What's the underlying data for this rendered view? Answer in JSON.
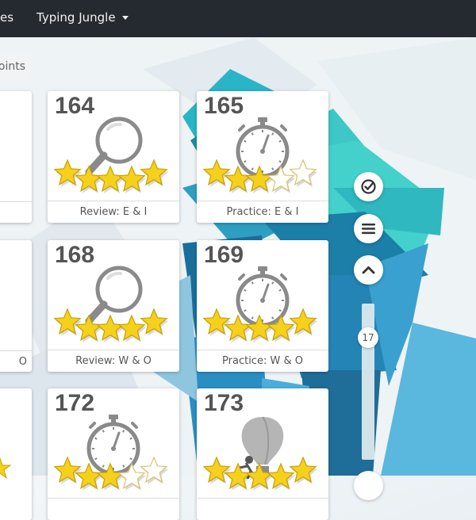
{
  "nav": {
    "prev_item_label": "es",
    "current_course_label": "Typing Jungle"
  },
  "points_tab": {
    "label": "oints"
  },
  "colors": {
    "nav_bg": "#252a30",
    "star_fill": "#f5d01c",
    "star_empty": "#ffffff",
    "icon_gray": "#888888"
  },
  "lessons": [
    {
      "number": "164",
      "title": "Review: E & I",
      "icon": "magnifier-icon",
      "stars_filled": 5,
      "stars_total": 5
    },
    {
      "number": "165",
      "title": "Practice: E & I",
      "icon": "stopwatch-icon",
      "stars_filled": 3,
      "stars_total": 5
    },
    {
      "number": "168",
      "title": "Review: W & O",
      "icon": "magnifier-icon",
      "stars_filled": 5,
      "stars_total": 5
    },
    {
      "number": "169",
      "title": "Practice: W & O",
      "icon": "stopwatch-icon",
      "stars_filled": 5,
      "stars_total": 5
    },
    {
      "number": "172",
      "title": "",
      "icon": "stopwatch-icon",
      "stars_filled": 3,
      "stars_total": 5
    },
    {
      "number": "173",
      "title": "",
      "icon": "balloon-icon",
      "stars_filled": 5,
      "stars_total": 5
    }
  ],
  "partial_left_cards": {
    "row2_footer_fragment": "O"
  },
  "scroll": {
    "position_label": "17"
  }
}
